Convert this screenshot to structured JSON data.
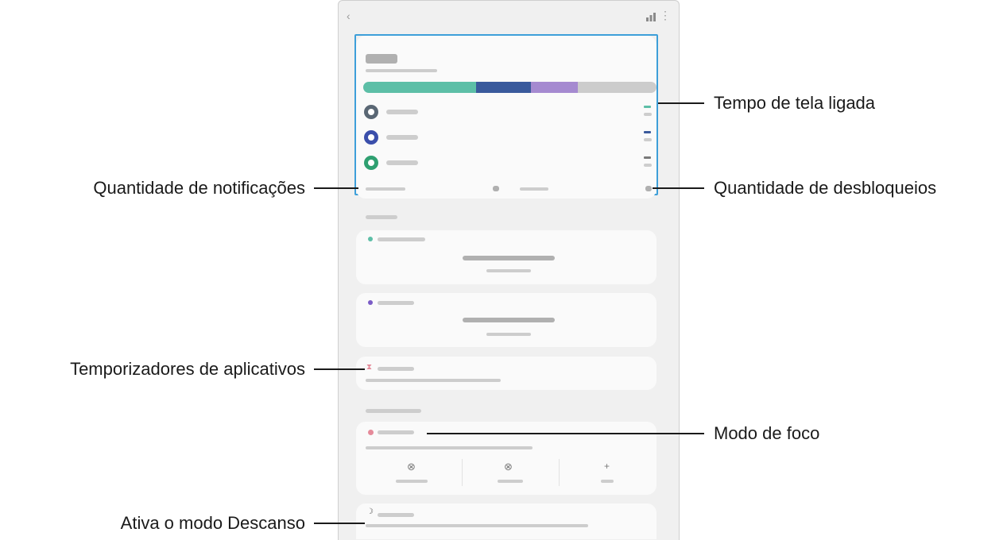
{
  "screen": {
    "brand_colors": {
      "highlight_border": "#3d9fd9",
      "bar_settings": "#5dbfa7",
      "bar_messages": "#3a5a9c",
      "bar_purple": "#a58ad0",
      "bar_rest": "#cccccc",
      "app_icon_1": "#5a6774",
      "app_icon_2": "#3b4fab",
      "app_icon_3": "#2fa071"
    },
    "icons": {
      "back": "back-arrow-icon",
      "chart": "bar-chart-icon",
      "more": "more-options-icon",
      "app_timer": "hourglass-icon",
      "focus": "focus-mode-icon",
      "wind_down": "moon-icon"
    },
    "glyphs": {
      "back": "‹",
      "more": "⋮",
      "app_timer": "⧗",
      "focus_btn_1": "⊗",
      "focus_btn_2": "⊗",
      "focus_btn_3": "+",
      "moon": "☽"
    }
  },
  "callouts": {
    "screen_time": "Tempo de tela ligada",
    "notifications": "Quantidade de notificações",
    "unlocks": "Quantidade de desbloqueios",
    "app_timers": "Temporizadores de aplicativos",
    "focus_mode": "Modo de foco",
    "wind_down": "Ativa o modo Descanso"
  }
}
